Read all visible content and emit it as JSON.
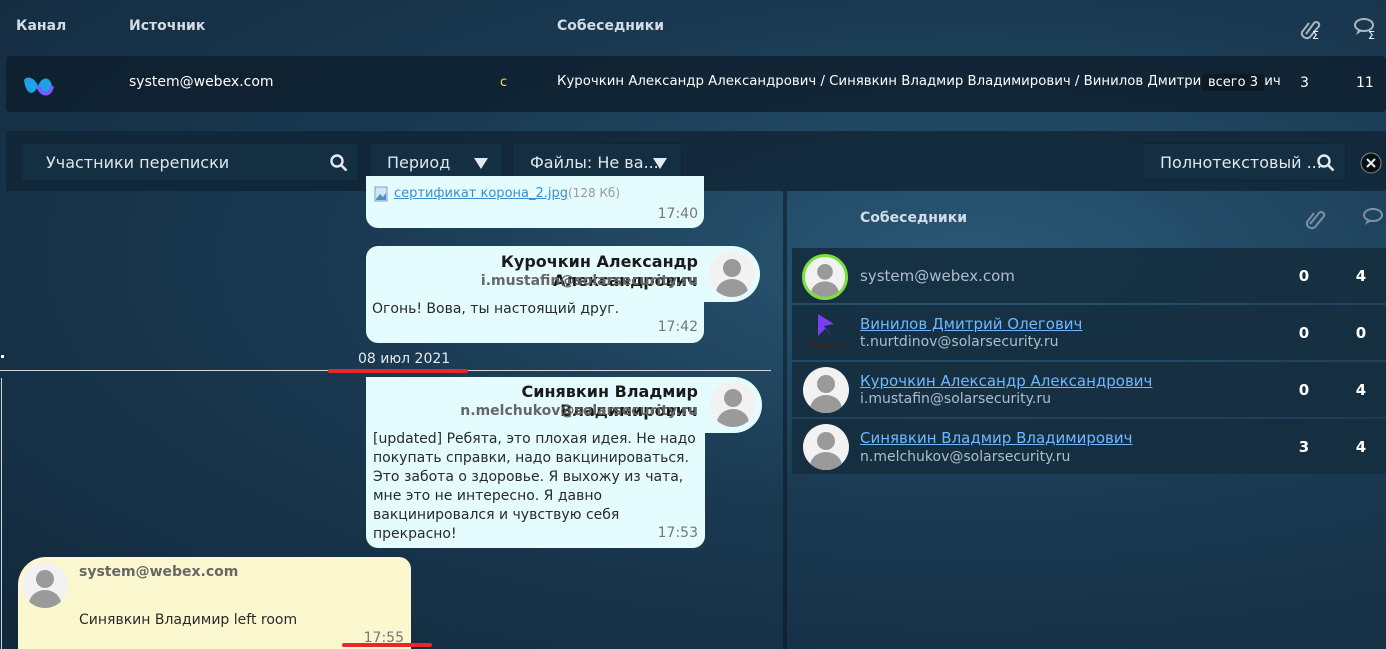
{
  "header": {
    "col_channel": "Канал",
    "col_source": "Источник",
    "col_participants": "Собеседники"
  },
  "top_row": {
    "source": "system@webex.com",
    "marker": "c",
    "participants": "Курочкин Александр Александрович / Синявкин Владмир Владимирович / Винилов Дмитрий Олегович",
    "total_badge": "всего 3",
    "attachments_count": "3",
    "messages_count": "11"
  },
  "filters": {
    "participants_placeholder": "Участники переписки",
    "period_label": "Период",
    "files_label": "Файлы: Не ва...",
    "fulltext_placeholder": "Полнотекстовый ..."
  },
  "chat": {
    "attachment_name": "сертификат корона_2.jpg",
    "attachment_size": "(128 Кб)",
    "msg0_time": "17:40",
    "msg1_sender": "Курочкин Александр Александрович",
    "msg1_email": "i.mustafin@solarsecurity.ru",
    "msg1_text": "Огонь! Вова, ты настоящий друг.",
    "msg1_time": "17:42",
    "date_sep": "08 июл 2021",
    "msg2_sender": "Синявкин Владмир Владимирович",
    "msg2_email": "n.melchukov@solarsecurity.ru",
    "msg2_text": "[updated] Ребята, это плохая идея. Не надо покупать справки, надо вакцинироваться. Это забота о здоровье. Я выхожу из чата, мне это не интересно. Я давно вакцинировался и чувствую себя прекрасно!",
    "msg2_time": "17:53",
    "msg3_sender": "system@webex.com",
    "msg3_text": "Синявкин Владимир left room",
    "msg3_time": "17:55"
  },
  "participants_panel": {
    "header": "Собеседники",
    "rows": [
      {
        "name": "",
        "email": "system@webex.com",
        "attachments": "0",
        "messages": "4"
      },
      {
        "name": "Винилов Дмитрий Олегович",
        "email": "t.nurtdinov@solarsecurity.ru",
        "attachments": "0",
        "messages": "0"
      },
      {
        "name": "Курочкин Александр Александрович",
        "email": "i.mustafin@solarsecurity.ru",
        "attachments": "0",
        "messages": "4"
      },
      {
        "name": "Синявкин Владмир Владимирович",
        "email": "n.melchukov@solarsecurity.ru",
        "attachments": "3",
        "messages": "4"
      }
    ]
  },
  "colors": {
    "background": "#1a3a52",
    "bubble_blue": "#e4fcfd",
    "bubble_yellow": "#fbf8cf",
    "link": "#6fb8ff",
    "accent_red": "#e8262c",
    "online_ring": "#7be03a"
  },
  "icons": [
    "webex-logo-icon",
    "paperclip-sum-icon",
    "chat-sum-icon",
    "search-icon",
    "dropdown-arrow-icon",
    "close-icon",
    "image-file-icon",
    "avatar-icon",
    "paperclip-icon",
    "chat-bubbles-icon"
  ]
}
